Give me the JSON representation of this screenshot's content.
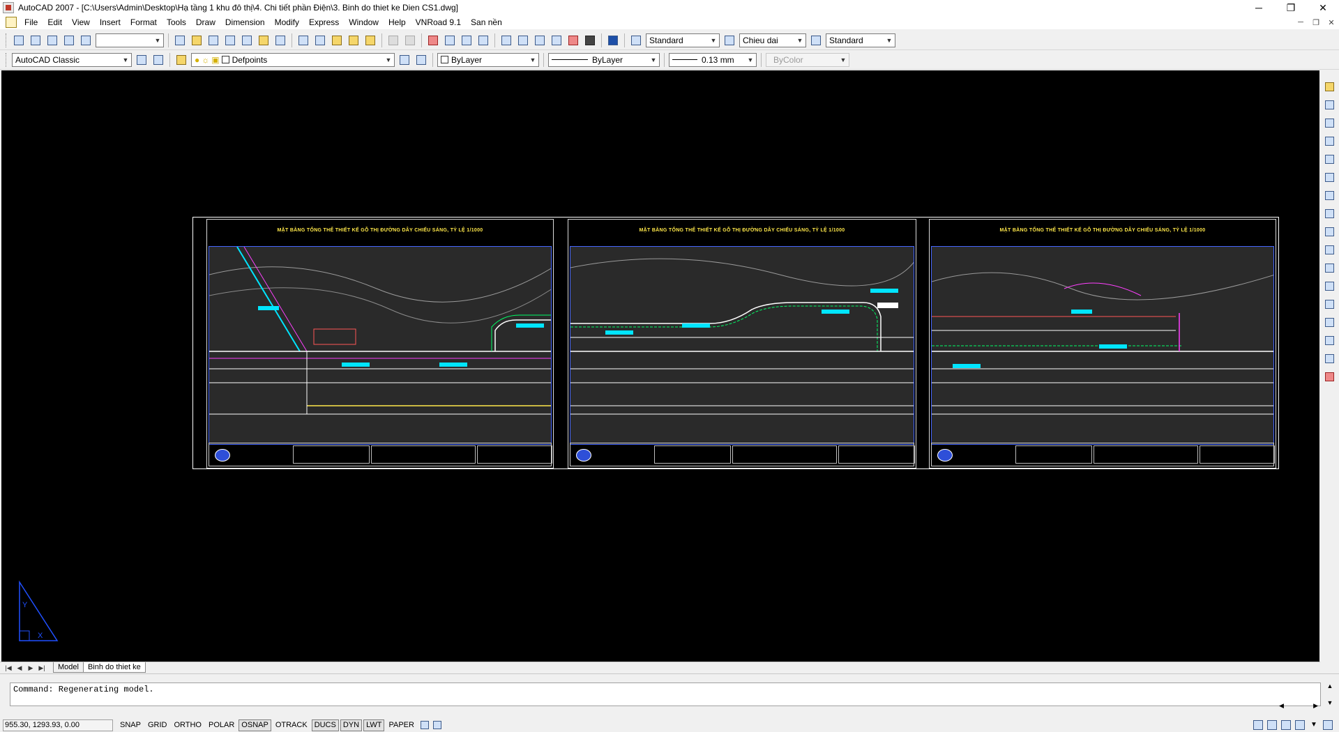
{
  "window": {
    "title": "AutoCAD 2007 - [C:\\Users\\Admin\\Desktop\\Hạ tầng 1 khu đô thị\\4. Chi tiết phần Điện\\3. Binh do thiet ke Dien CS1.dwg]",
    "controls": [
      "─",
      "❐",
      "✕"
    ]
  },
  "menu": {
    "items": [
      "File",
      "Edit",
      "View",
      "Insert",
      "Format",
      "Tools",
      "Draw",
      "Dimension",
      "Modify",
      "Express",
      "Window",
      "Help",
      "VNRoad 9.1",
      "San nền"
    ],
    "mdi_controls": [
      "─",
      "❐",
      "✕"
    ]
  },
  "toolbar1": {
    "named_view_value": "",
    "text_style": "Standard",
    "dim_style": "Chieu dai",
    "table_style": "Standard"
  },
  "toolbar2": {
    "workspace": "AutoCAD Classic",
    "layer": "Defpoints",
    "color": "ByLayer",
    "linetype": "ByLayer",
    "lineweight": "0.13 mm",
    "plot_style": "ByColor"
  },
  "drawing": {
    "sheets": [
      {
        "title": "MẶT BẰNG TỔNG THỂ THIẾT KẾ GỖ THỊ ĐƯỜNG DÂY CHIẾU SÁNG, TỶ LỆ 1/1000"
      },
      {
        "title": "MẶT BẰNG TỔNG THỂ THIẾT KẾ GỖ THỊ ĐƯỜNG DÂY CHIẾU SÁNG, TỶ LỆ 1/1000"
      },
      {
        "title": "MẶT BẰNG TỔNG THỂ THIẾT KẾ GỖ THỊ ĐƯỜNG DÂY CHIẾU SÁNG, TỶ LỆ 1/1000"
      }
    ],
    "ucs": {
      "x": "X",
      "y": "Y"
    }
  },
  "tabs": {
    "nav": [
      "|◀",
      "◀",
      "▶",
      "▶|"
    ],
    "items": [
      "Model",
      "Binh do thiet ke"
    ],
    "active": "Binh do thiet ke"
  },
  "command": {
    "line": "Command: Regenerating model."
  },
  "status": {
    "coords": "955.30, 1293.93, 0.00",
    "buttons": [
      "SNAP",
      "GRID",
      "ORTHO",
      "POLAR",
      "OSNAP",
      "OTRACK",
      "DUCS",
      "DYN",
      "LWT",
      "PAPER"
    ],
    "active": [
      "OSNAP",
      "DUCS",
      "DYN",
      "LWT"
    ]
  },
  "colors": {
    "canvas": "#000000",
    "title_text": "#ffe84a",
    "map_border": "#4466ff",
    "titleblock_text": "#33ff33"
  }
}
